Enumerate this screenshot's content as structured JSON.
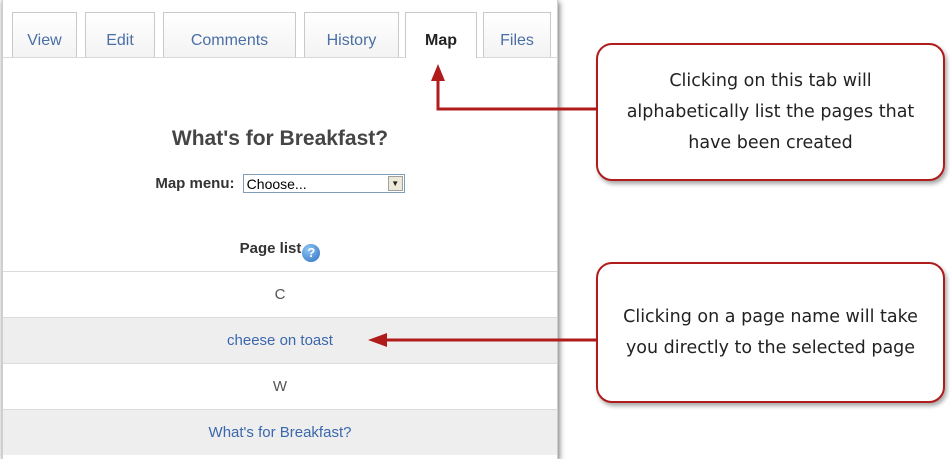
{
  "tabs": [
    {
      "label": "View",
      "active": false
    },
    {
      "label": "Edit",
      "active": false
    },
    {
      "label": "Comments",
      "active": false
    },
    {
      "label": "History",
      "active": false
    },
    {
      "label": "Map",
      "active": true
    },
    {
      "label": "Files",
      "active": false
    }
  ],
  "page_title": "What's for Breakfast?",
  "map_menu": {
    "label": "Map menu:",
    "selected": "Choose..."
  },
  "page_list": {
    "heading": "Page list",
    "rows": [
      {
        "text": "C",
        "kind": "letter"
      },
      {
        "text": "cheese on toast",
        "kind": "link"
      },
      {
        "text": "W",
        "kind": "letter"
      },
      {
        "text": "What's for Breakfast?",
        "kind": "link"
      }
    ]
  },
  "icons": {
    "help": "help-question-icon",
    "dropdown": "dropdown-arrow-icon"
  },
  "callouts": [
    {
      "text": "Clicking on this tab will alphabetically list the pages that have been created"
    },
    {
      "text": "Clicking on a page name will take you directly to the selected page"
    }
  ],
  "colors": {
    "callout_border": "#b01c1c",
    "link": "#3a67ad",
    "tab_text": "#4a6fa5",
    "row_alt_bg": "#eeeeee"
  }
}
